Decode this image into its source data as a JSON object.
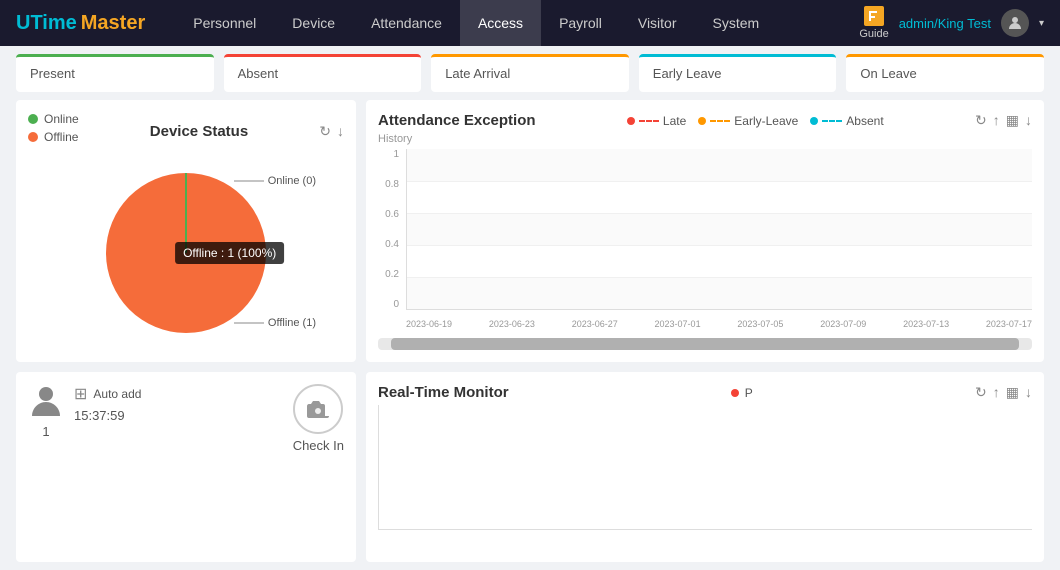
{
  "header": {
    "logo_utime": "UTime",
    "logo_master": "Master",
    "nav_items": [
      {
        "label": "Personnel",
        "active": false
      },
      {
        "label": "Device",
        "active": false
      },
      {
        "label": "Attendance",
        "active": false
      },
      {
        "label": "Access",
        "active": true
      },
      {
        "label": "Payroll",
        "active": false
      },
      {
        "label": "Visitor",
        "active": false
      },
      {
        "label": "System",
        "active": false
      }
    ],
    "guide_label": "Guide",
    "user": "admin/King Test",
    "dropdown_arrow": "▾"
  },
  "stats": [
    {
      "label": "Present",
      "color": "#4caf50",
      "class": "present"
    },
    {
      "label": "Absent",
      "color": "#f44336",
      "class": "absent"
    },
    {
      "label": "Late Arrival",
      "color": "#ff9800",
      "class": "late"
    },
    {
      "label": "Early Leave",
      "color": "#00bcd4",
      "class": "early"
    },
    {
      "label": "On Leave",
      "color": "#ff9800",
      "class": "onleave"
    }
  ],
  "device_status": {
    "title": "Device Status",
    "legend": [
      {
        "label": "Online",
        "class": "online"
      },
      {
        "label": "Offline",
        "class": "offline"
      }
    ],
    "online_label": "Online (0)",
    "offline_label": "Offline (1)",
    "tooltip": "Offline : 1 (100%)",
    "refresh_icon": "↻",
    "download_icon": "↓"
  },
  "attendance_exception": {
    "title": "Attendance Exception",
    "history_label": "History",
    "legend": [
      {
        "label": "Late",
        "class": "late"
      },
      {
        "label": "Early-Leave",
        "class": "early"
      },
      {
        "label": "Absent",
        "class": "absent"
      }
    ],
    "y_labels": [
      "1",
      "0.8",
      "0.6",
      "0.4",
      "0.2",
      "0"
    ],
    "x_labels": [
      "2023-06-19",
      "2023-06-23",
      "2023-06-27",
      "2023-07-01",
      "2023-07-05",
      "2023-07-09",
      "2023-07-13",
      "2023-07-17"
    ],
    "refresh_icon": "↻",
    "upload_icon": "↑",
    "bar_icon": "▦",
    "download_icon": "↓"
  },
  "checkin": {
    "person_count": "1",
    "auto_add_label": "Auto add",
    "time": "15:37:59",
    "check_in_label": "Check In"
  },
  "realtime": {
    "title": "Real-Time Monitor",
    "p_label": "P",
    "refresh_icon": "↻",
    "upload_icon": "↑",
    "bar_icon": "▦",
    "download_icon": "↓"
  }
}
